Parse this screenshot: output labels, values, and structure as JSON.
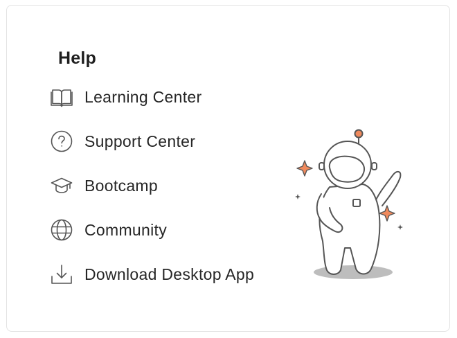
{
  "help": {
    "title": "Help",
    "items": [
      {
        "label": "Learning Center",
        "icon": "book-icon"
      },
      {
        "label": "Support Center",
        "icon": "question-icon"
      },
      {
        "label": "Bootcamp",
        "icon": "graduation-cap-icon"
      },
      {
        "label": "Community",
        "icon": "globe-icon"
      },
      {
        "label": "Download Desktop App",
        "icon": "download-icon"
      }
    ]
  },
  "colors": {
    "icon_stroke": "#555555",
    "text": "#262626",
    "accent": "#f08a5d",
    "shadow": "#bdbdbd"
  }
}
